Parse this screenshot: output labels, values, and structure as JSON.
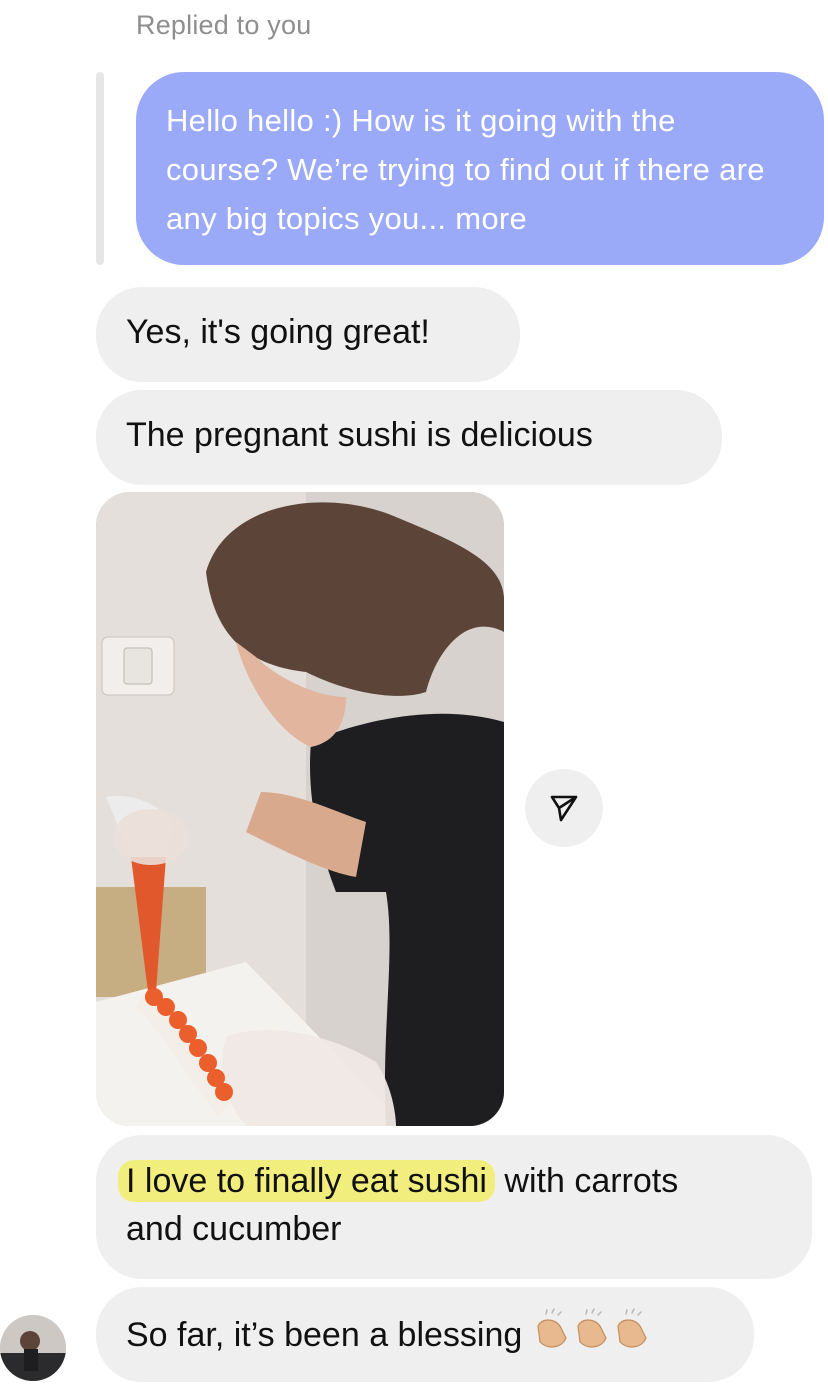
{
  "thread": {
    "reply_context": {
      "label": "Replied to you",
      "quoted_text": "Hello hello :) How is it going with the course? We’re trying to find out if there are any big topics you... more"
    },
    "messages": [
      {
        "text": "Yes, it's going great!"
      },
      {
        "text": "The pregnant sushi is delicious"
      },
      {
        "media": {
          "type": "video",
          "icon": "share-icon"
        }
      },
      {
        "highlight": "I love to finally eat sushi",
        "rest_line1": " with carrots",
        "line2": "and cucumber"
      },
      {
        "text": "So far, it’s been a blessing",
        "emoji_icon": "clapping-hands-icon"
      }
    ],
    "colors": {
      "quoted_bubble": "#9aaaf8",
      "incoming_bubble": "#efefef",
      "highlight": "#f2ee7e"
    }
  }
}
